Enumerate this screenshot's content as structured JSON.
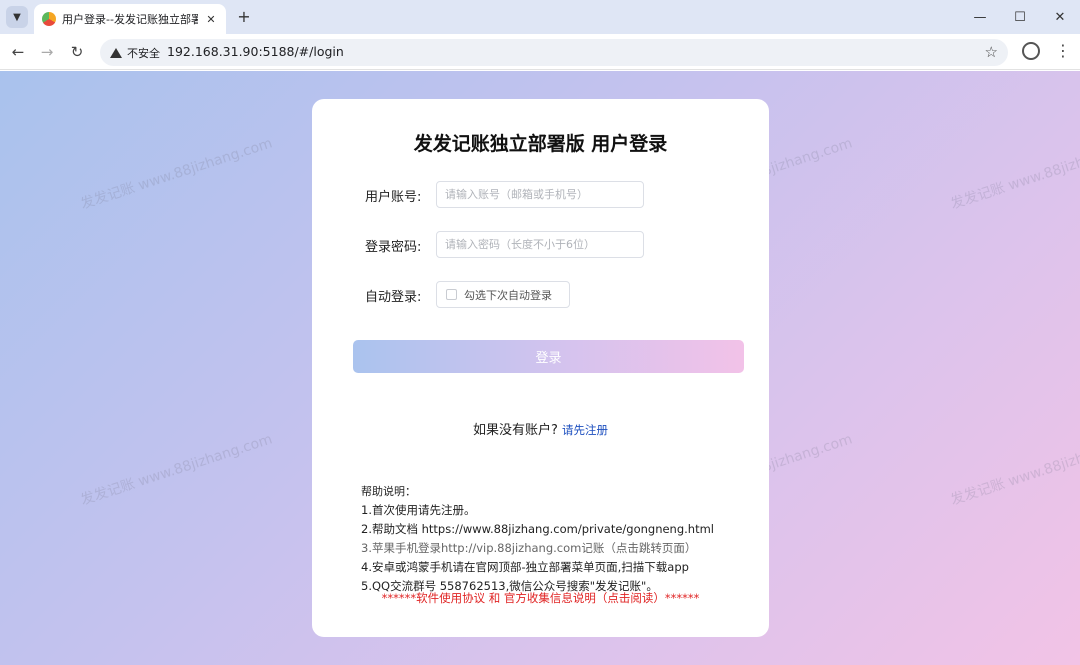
{
  "browser": {
    "tab": {
      "title": "用户登录--发发记账独立部署版",
      "close": "✕"
    },
    "new_tab": "+",
    "address": {
      "security_label": "不安全",
      "url": "192.168.31.90:5188/#/login"
    },
    "nav": {
      "back": "←",
      "forward": "→",
      "reload": "↻"
    },
    "window": {
      "minimize": "—",
      "maximize": "☐",
      "close": "✕"
    },
    "bookmark": "☆",
    "menu": "⋮"
  },
  "page": {
    "watermark": "发发记账 www.88jizhang.com",
    "title": "发发记账独立部署版 用户登录",
    "form": {
      "account_label": "用户账号:",
      "account_placeholder": "请输入账号（邮箱或手机号）",
      "password_label": "登录密码:",
      "password_placeholder": "请输入密码（长度不小于6位）",
      "auto_label": "自动登录:",
      "auto_checkbox_text": "勾选下次自动登录"
    },
    "login_button": "登录",
    "register": {
      "prompt": "如果没有账户?",
      "link": "请先注册"
    },
    "help": {
      "title": "帮助说明：",
      "items": [
        "1.首次使用请先注册。",
        "2.帮助文档  https://www.88jizhang.com/private/gongneng.html",
        "3.苹果手机登录http://vip.88jizhang.com记账（点击跳转页面）",
        "4.安卓或鸿蒙手机请在官网顶部-独立部署菜单页面,扫描下载app",
        "5.QQ交流群号 558762513,微信公众号搜索\"发发记账\"。"
      ],
      "notice": "******软件使用协议 和 官方收集信息说明（点击阅读）******"
    }
  }
}
